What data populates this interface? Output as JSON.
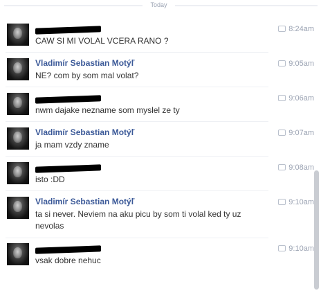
{
  "divider": {
    "label": "Today"
  },
  "messages": [
    {
      "sender": "",
      "redacted": true,
      "text": "CAW SI MI VOLAL VCERA RANO ?",
      "time": "8:24am"
    },
    {
      "sender": "Vladimír Sebastian Motýľ",
      "redacted": false,
      "text": "NE? com by som mal volat?",
      "time": "9:05am"
    },
    {
      "sender": "",
      "redacted": true,
      "text": "nwm dajake nezname som myslel ze ty",
      "time": "9:06am"
    },
    {
      "sender": "Vladimír Sebastian Motýľ",
      "redacted": false,
      "text": "ja mam vzdy zname",
      "time": "9:07am"
    },
    {
      "sender": "",
      "redacted": true,
      "text": "isto :DD",
      "time": "9:08am"
    },
    {
      "sender": "Vladimír Sebastian Motýľ",
      "redacted": false,
      "text": "ta si never. Neviem na aku picu by som ti volal ked ty uz nevolas",
      "time": "9:10am"
    },
    {
      "sender": "",
      "redacted": true,
      "text": "vsak dobre nehuc",
      "time": "9:10am"
    }
  ]
}
